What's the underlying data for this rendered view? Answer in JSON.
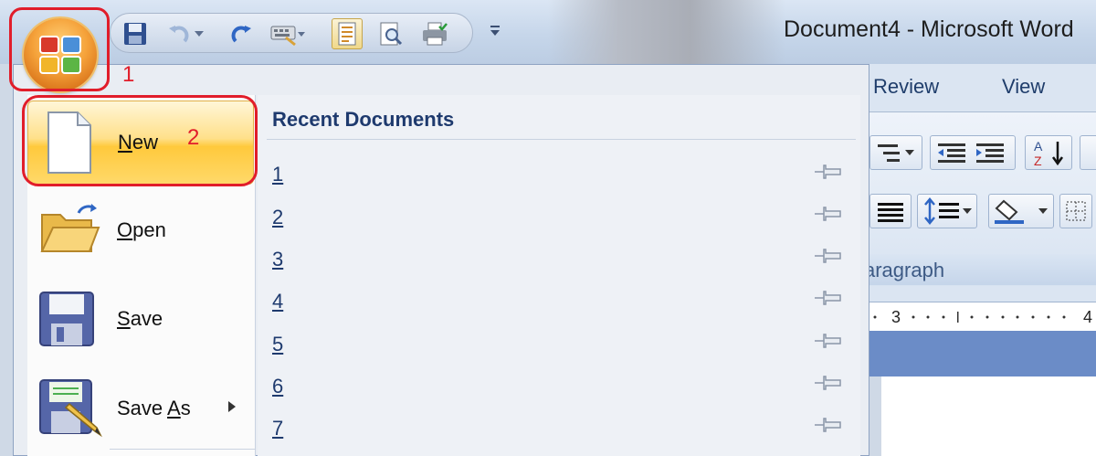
{
  "window": {
    "title": "Document4 - Microsoft Word"
  },
  "annotations": {
    "step1": "1",
    "step2": "2"
  },
  "ribbon": {
    "tabs": [
      {
        "label": "Review"
      },
      {
        "label": "View"
      }
    ],
    "group_label": "aragraph",
    "ruler": {
      "tick_3": "3",
      "tick_4": "4"
    }
  },
  "menu": {
    "items": [
      {
        "label": "New",
        "accel": "N",
        "rest": "ew",
        "icon": "new-document-icon"
      },
      {
        "label": "Open",
        "accel": "O",
        "rest": "pen",
        "icon": "folder-open-icon"
      },
      {
        "label": "Save",
        "accel": "S",
        "rest": "ave",
        "icon": "floppy-disk-icon"
      },
      {
        "label": "Save As",
        "pre": "Save ",
        "accel": "A",
        "rest": "s",
        "icon": "save-as-icon"
      }
    ],
    "recent": {
      "title": "Recent Documents",
      "items": [
        "1",
        "2",
        "3",
        "4",
        "5",
        "6",
        "7"
      ]
    }
  },
  "colors": {
    "annotation": "#e11d2a",
    "highlight": "#ffd96a",
    "link": "#1e3a6e"
  }
}
